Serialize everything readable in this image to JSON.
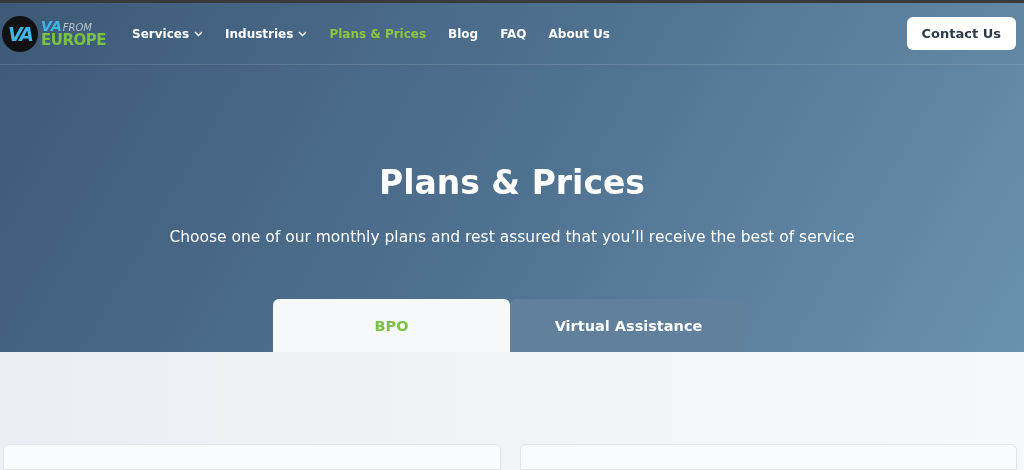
{
  "logo": {
    "mark": "VA",
    "top": "VA",
    "small": "FROM",
    "bottom": "EUROPE"
  },
  "nav": [
    {
      "label": "Services",
      "dropdown": true,
      "selected": false
    },
    {
      "label": "Industries",
      "dropdown": true,
      "selected": false
    },
    {
      "label": "Plans & Prices",
      "dropdown": false,
      "selected": true
    },
    {
      "label": "Blog",
      "dropdown": false,
      "selected": false
    },
    {
      "label": "FAQ",
      "dropdown": false,
      "selected": false
    },
    {
      "label": "About Us",
      "dropdown": false,
      "selected": false
    }
  ],
  "contact_button": "Contact Us",
  "hero": {
    "title": "Plans & Prices",
    "subtitle": "Choose one of our monthly plans and rest assured that you’ll receive the best of service"
  },
  "tabs": [
    {
      "label": "BPO",
      "selected": true
    },
    {
      "label": "Virtual Assistance",
      "selected": false
    }
  ],
  "cards": [
    {
      "kind": "plan"
    },
    {
      "kind": "plan"
    }
  ]
}
